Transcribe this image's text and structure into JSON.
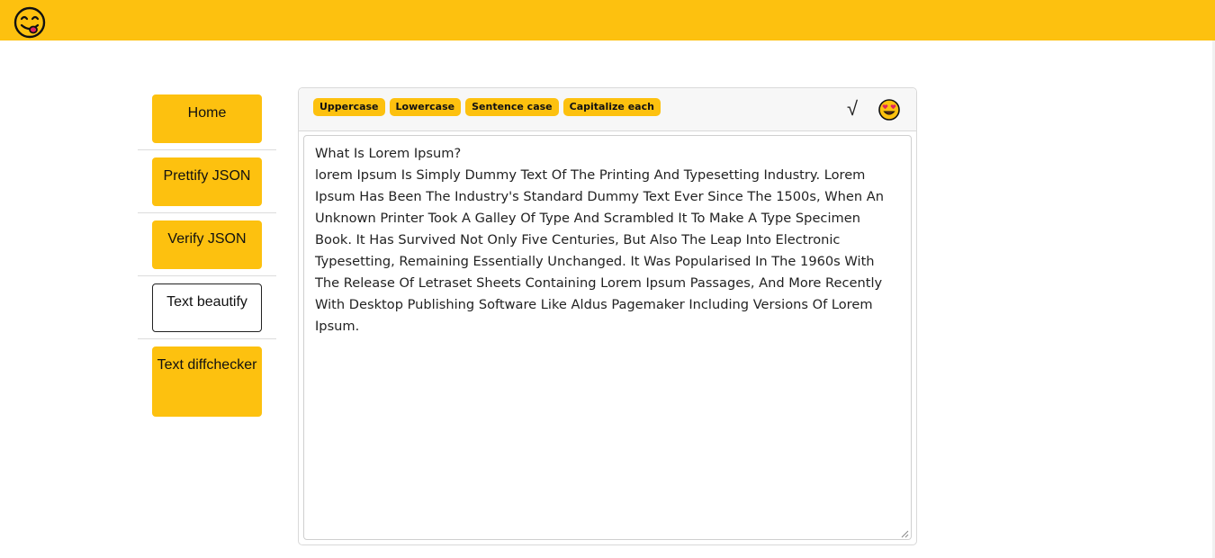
{
  "header": {
    "logo_icon": "face-savoring-food-emoji"
  },
  "sidebar": {
    "items": [
      {
        "label": "Home",
        "active": false
      },
      {
        "label": "Prettify JSON",
        "active": false
      },
      {
        "label": "Verify JSON",
        "active": false
      },
      {
        "label": "Text beautify",
        "active": true
      },
      {
        "label": "Text diffchecker",
        "active": false
      }
    ]
  },
  "editor": {
    "toolbar": {
      "uppercase_label": "Uppercase",
      "lowercase_label": "Lowercase",
      "sentence_case_label": "Sentence case",
      "capitalize_each_label": "Capitalize each",
      "check_label": "√",
      "emoji_icon": "smiling-face-with-heart-eyes-emoji"
    },
    "text": "What Is Lorem Ipsum?\nlorem Ipsum Is Simply Dummy Text Of The Printing And Typesetting Industry. Lorem Ipsum Has Been The Industry's Standard Dummy Text Ever Since The 1500s, When An Unknown Printer Took A Galley Of Type And Scrambled It To Make A Type Specimen Book. It Has Survived Not Only Five Centuries, But Also The Leap Into Electronic Typesetting, Remaining Essentially Unchanged. It Was Popularised In The 1960s With The Release Of Letraset Sheets Containing Lorem Ipsum Passages, And More Recently With Desktop Publishing Software Like Aldus Pagemaker Including Versions Of Lorem Ipsum."
  },
  "colors": {
    "accent": "#fdc10f",
    "border": "#d9d9d9",
    "header_bg": "#f7f7f7"
  }
}
